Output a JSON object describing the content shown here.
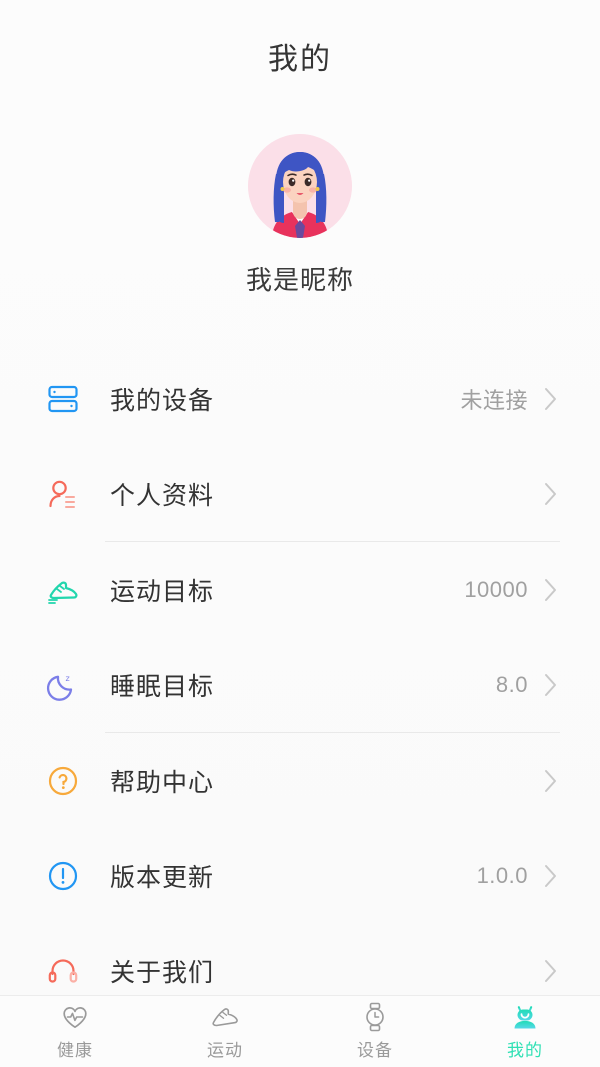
{
  "header": {
    "title": "我的"
  },
  "profile": {
    "avatar_icon": "user-avatar-illustration",
    "nickname": "我是昵称"
  },
  "colors": {
    "device_icon": "#2196f3",
    "profile_icon": "#f56a5a",
    "sport_icon": "#22d6ad",
    "sleep_icon": "#7b7ee8",
    "help_icon": "#f7a93b",
    "update_icon": "#2196f3",
    "about_icon": "#f56a5a",
    "active_tab": "#2fe0b4",
    "inactive_tab": "#9a9a9a",
    "divider": "#e9e9e9",
    "value_text": "#a0a0a0",
    "label_text": "#333333",
    "chevron": "#c9c9c9"
  },
  "list": {
    "groups": [
      {
        "items": [
          {
            "id": "my-device",
            "icon": "device-icon",
            "label": "我的设备",
            "value": "未连接"
          },
          {
            "id": "personal-profile",
            "icon": "person-info-icon",
            "label": "个人资料",
            "value": ""
          }
        ]
      },
      {
        "items": [
          {
            "id": "sport-goal",
            "icon": "sneaker-icon",
            "label": "运动目标",
            "value": "10000"
          },
          {
            "id": "sleep-goal",
            "icon": "moon-sleep-icon",
            "label": "睡眠目标",
            "value": "8.0"
          }
        ]
      },
      {
        "items": [
          {
            "id": "help-center",
            "icon": "question-circle-icon",
            "label": "帮助中心",
            "value": ""
          },
          {
            "id": "version-update",
            "icon": "exclamation-circle-icon",
            "label": "版本更新",
            "value": "1.0.0"
          },
          {
            "id": "about-us",
            "icon": "headset-icon",
            "label": "关于我们",
            "value": ""
          }
        ]
      }
    ]
  },
  "tabbar": {
    "tabs": [
      {
        "id": "health",
        "icon": "heart-pulse-icon",
        "label": "健康",
        "active": false
      },
      {
        "id": "sport",
        "icon": "shoe-icon",
        "label": "运动",
        "active": false
      },
      {
        "id": "device",
        "icon": "watch-icon",
        "label": "设备",
        "active": false
      },
      {
        "id": "mine",
        "icon": "robot-avatar-icon",
        "label": "我的",
        "active": true
      }
    ]
  }
}
